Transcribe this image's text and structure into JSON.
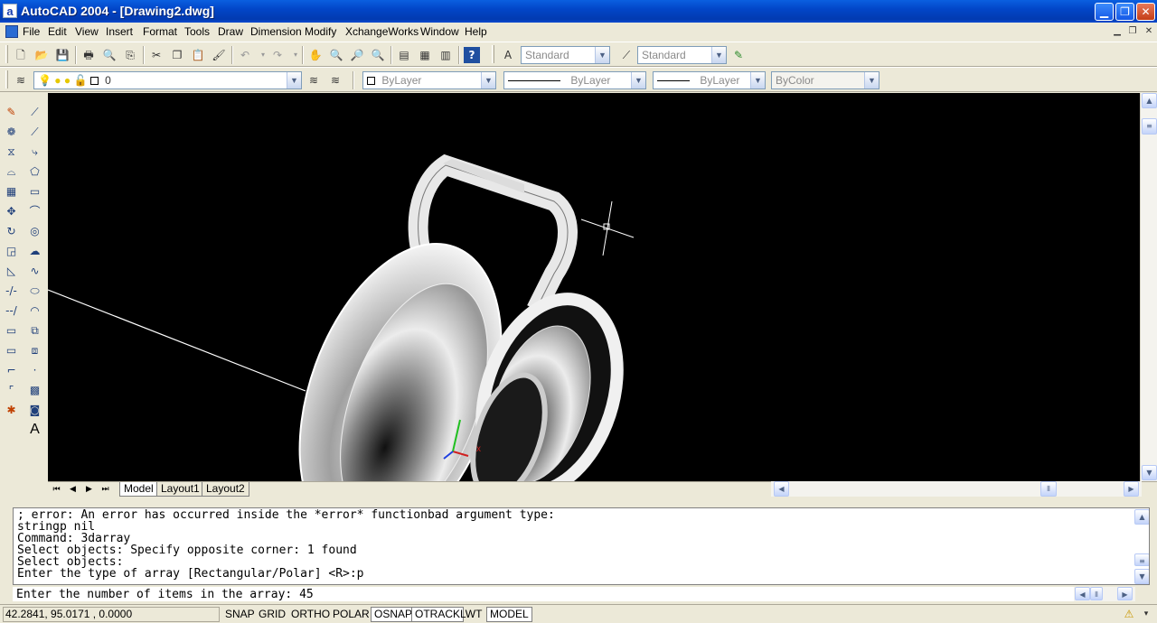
{
  "window": {
    "app_icon": "a",
    "title": "AutoCAD 2004 - [Drawing2.dwg]",
    "minimize": "▁",
    "restore": "❐",
    "close": "✕"
  },
  "menu": {
    "items": [
      "File",
      "Edit",
      "View",
      "Insert",
      "Format",
      "Tools",
      "Draw",
      "Dimension",
      "Modify",
      "XchangeWorks",
      "Window",
      "Help"
    ],
    "doc_minimize": "▁",
    "doc_restore": "❐",
    "doc_close": "✕"
  },
  "toolbar": {
    "text_style": "Standard",
    "dim_style": "Standard",
    "layer": "0",
    "color": "ByLayer",
    "linetype": "ByLayer",
    "lineweight": "ByLayer",
    "plotstyle": "ByColor",
    "help_icon": "?"
  },
  "draw_toolbar": {
    "text_icon": "A"
  },
  "tabs": {
    "items": [
      "Model",
      "Layout1",
      "Layout2"
    ],
    "active": "Model"
  },
  "command": {
    "history": [
      "; error: An error has occurred inside the *error* functionbad argument type:",
      "stringp nil",
      "Command: 3darray",
      "Select objects: Specify opposite corner: 1 found",
      "Select objects:",
      "Enter the type of array [Rectangular/Polar] <R>:p"
    ],
    "prompt": "Enter the number of items in the array: 45"
  },
  "status": {
    "coordinates": "42.2841, 95.0171 , 0.0000",
    "buttons": [
      {
        "label": "SNAP",
        "on": false
      },
      {
        "label": "GRID",
        "on": false
      },
      {
        "label": "ORTHO",
        "on": false
      },
      {
        "label": "POLAR",
        "on": false
      },
      {
        "label": "OSNAP",
        "on": true
      },
      {
        "label": "OTRACK",
        "on": true
      },
      {
        "label": "LWT",
        "on": false
      },
      {
        "label": "MODEL",
        "on": true
      }
    ]
  },
  "colors": {
    "canvas": "#000000",
    "titlebar": "#0246c8",
    "chrome": "#ece9d8"
  }
}
